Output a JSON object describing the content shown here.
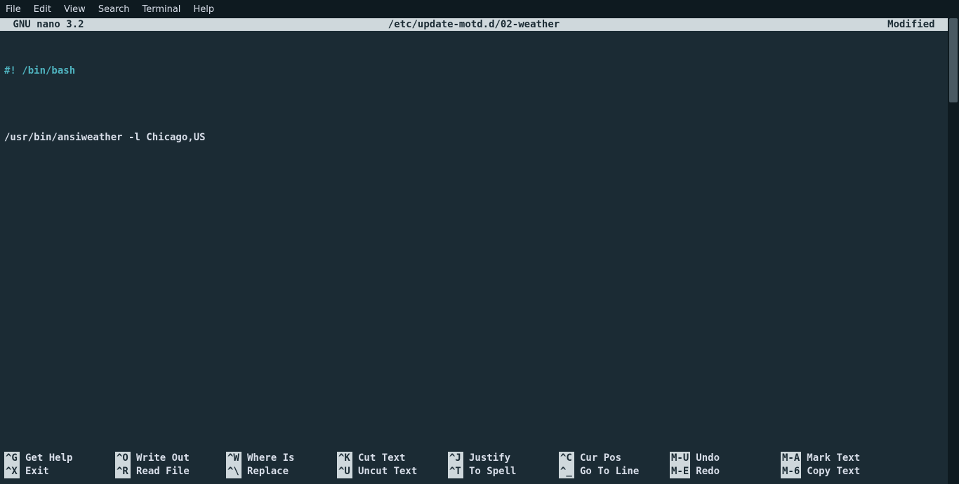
{
  "menubar": {
    "items": [
      "File",
      "Edit",
      "View",
      "Search",
      "Terminal",
      "Help"
    ]
  },
  "nano": {
    "title_left": " GNU nano 3.2",
    "title_center": "/etc/update-motd.d/02-weather",
    "title_right": "Modified "
  },
  "editor": {
    "line1_prefix": "#!",
    "line1_rest": " /bin/bash",
    "line2": "",
    "line3": "/usr/bin/ansiweather -l Chicago,US"
  },
  "shortcuts": {
    "row1": [
      {
        "key": "^G",
        "label": "Get Help"
      },
      {
        "key": "^O",
        "label": "Write Out"
      },
      {
        "key": "^W",
        "label": "Where Is"
      },
      {
        "key": "^K",
        "label": "Cut Text"
      },
      {
        "key": "^J",
        "label": "Justify"
      },
      {
        "key": "^C",
        "label": "Cur Pos"
      },
      {
        "key": "M-U",
        "label": "Undo"
      },
      {
        "key": "M-A",
        "label": "Mark Text"
      }
    ],
    "row2": [
      {
        "key": "^X",
        "label": "Exit"
      },
      {
        "key": "^R",
        "label": "Read File"
      },
      {
        "key": "^\\",
        "label": "Replace"
      },
      {
        "key": "^U",
        "label": "Uncut Text"
      },
      {
        "key": "^T",
        "label": "To Spell"
      },
      {
        "key": "^_",
        "label": "Go To Line"
      },
      {
        "key": "M-E",
        "label": "Redo"
      },
      {
        "key": "M-6",
        "label": "Copy Text"
      }
    ]
  }
}
